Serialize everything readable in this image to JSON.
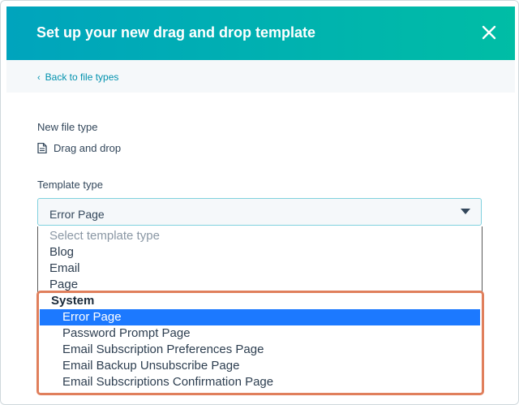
{
  "modal": {
    "title": "Set up your new drag and drop template",
    "close_icon": "close-icon"
  },
  "back_link": {
    "label": "Back to file types",
    "icon": "chevron-left-icon"
  },
  "new_file_type": {
    "label": "New file type",
    "value": "Drag and drop",
    "icon": "document-icon"
  },
  "template_type": {
    "label": "Template type",
    "selected": "Error Page",
    "options": {
      "placeholder": "Select template type",
      "blog": "Blog",
      "email": "Email",
      "page": "Page",
      "group_system": "System",
      "system": [
        "Error Page",
        "Password Prompt Page",
        "Email Subscription Preferences Page",
        "Email Backup Unsubscribe Page",
        "Email Subscriptions Confirmation Page"
      ]
    }
  },
  "colors": {
    "header_start": "#00a4bd",
    "header_end": "#00bda5",
    "link": "#0091ae",
    "selected_option": "#1c79ff",
    "highlight_border": "#e07f5c"
  }
}
